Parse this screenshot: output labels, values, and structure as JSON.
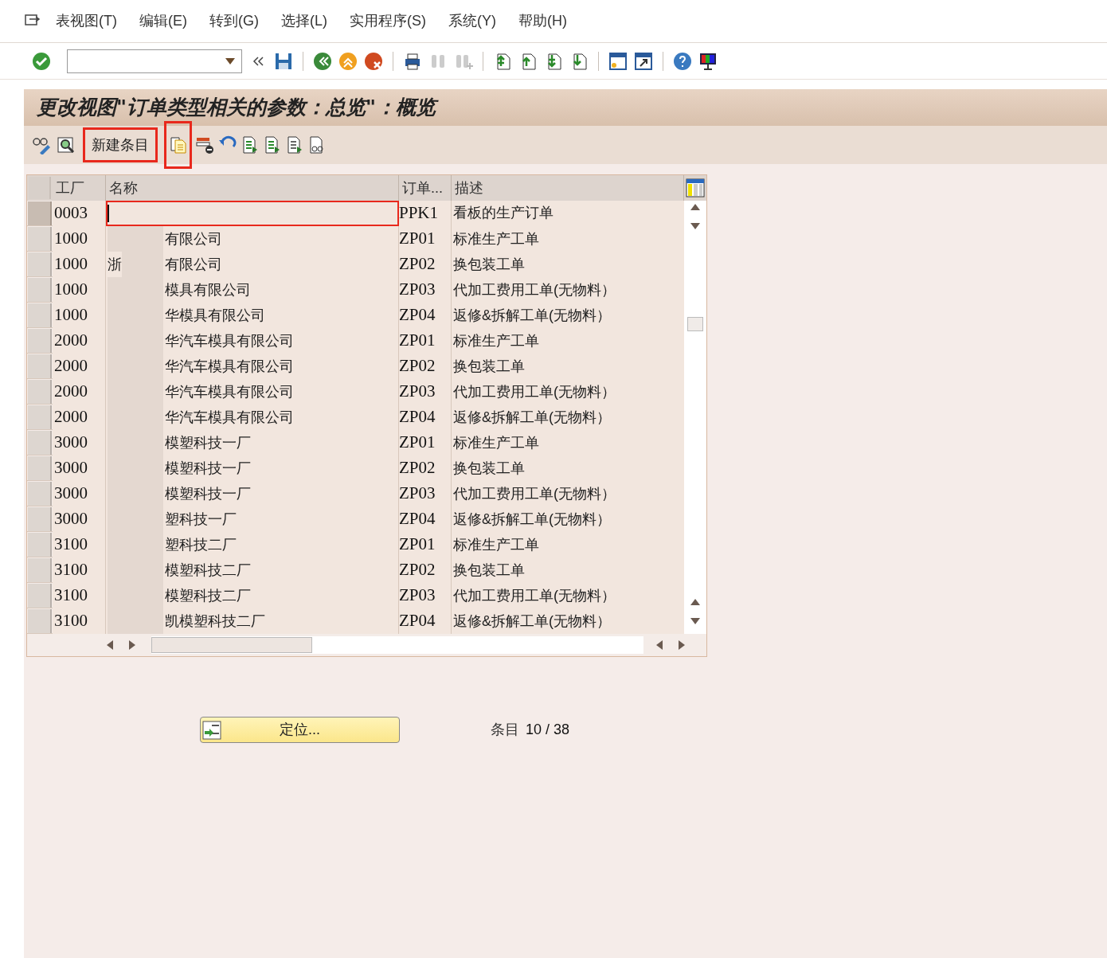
{
  "menu": [
    "表视图(T)",
    "编辑(E)",
    "转到(G)",
    "选择(L)",
    "实用程序(S)",
    "系统(Y)",
    "帮助(H)"
  ],
  "title": "更改视图\"订单类型相关的参数：总览\"：概览",
  "app_toolbar": {
    "new_entries": "新建条目"
  },
  "table": {
    "columns": [
      "工厂",
      "名称",
      "订单...",
      "描述"
    ],
    "rows": [
      {
        "plant": "0003",
        "name_prefix": "",
        "name": "",
        "order": "PPK1",
        "desc": "看板的生产订单",
        "selected": true
      },
      {
        "plant": "1000",
        "name_prefix": "",
        "name": "有限公司",
        "order": "ZP01",
        "desc": "标准生产工单",
        "selected": false
      },
      {
        "plant": "1000",
        "name_prefix": "浙",
        "name": "有限公司",
        "order": "ZP02",
        "desc": "换包装工单",
        "selected": false
      },
      {
        "plant": "1000",
        "name_prefix": "",
        "name": "模具有限公司",
        "order": "ZP03",
        "desc": "代加工费用工单(无物料）",
        "selected": false
      },
      {
        "plant": "1000",
        "name_prefix": "",
        "name": "华模具有限公司",
        "order": "ZP04",
        "desc": "返修&拆解工单(无物料）",
        "selected": false
      },
      {
        "plant": "2000",
        "name_prefix": "",
        "name": "华汽车模具有限公司",
        "order": "ZP01",
        "desc": "标准生产工单",
        "selected": false
      },
      {
        "plant": "2000",
        "name_prefix": "",
        "name": "华汽车模具有限公司",
        "order": "ZP02",
        "desc": "换包装工单",
        "selected": false
      },
      {
        "plant": "2000",
        "name_prefix": "",
        "name": "华汽车模具有限公司",
        "order": "ZP03",
        "desc": "代加工费用工单(无物料）",
        "selected": false
      },
      {
        "plant": "2000",
        "name_prefix": "",
        "name": "华汽车模具有限公司",
        "order": "ZP04",
        "desc": "返修&拆解工单(无物料）",
        "selected": false
      },
      {
        "plant": "3000",
        "name_prefix": "",
        "name": "模塑科技一厂",
        "order": "ZP01",
        "desc": "标准生产工单",
        "selected": false
      },
      {
        "plant": "3000",
        "name_prefix": "",
        "name": "模塑科技一厂",
        "order": "ZP02",
        "desc": "换包装工单",
        "selected": false
      },
      {
        "plant": "3000",
        "name_prefix": "",
        "name": "模塑科技一厂",
        "order": "ZP03",
        "desc": "代加工费用工单(无物料）",
        "selected": false
      },
      {
        "plant": "3000",
        "name_prefix": "",
        "name": "塑科技一厂",
        "order": "ZP04",
        "desc": "返修&拆解工单(无物料）",
        "selected": false
      },
      {
        "plant": "3100",
        "name_prefix": "",
        "name": "塑科技二厂",
        "order": "ZP01",
        "desc": "标准生产工单",
        "selected": false
      },
      {
        "plant": "3100",
        "name_prefix": "",
        "name": "模塑科技二厂",
        "order": "ZP02",
        "desc": "换包装工单",
        "selected": false
      },
      {
        "plant": "3100",
        "name_prefix": "",
        "name": "模塑科技二厂",
        "order": "ZP03",
        "desc": "代加工费用工单(无物料）",
        "selected": false
      },
      {
        "plant": "3100",
        "name_prefix": "",
        "name": "凯模塑科技二厂",
        "order": "ZP04",
        "desc": "返修&拆解工单(无物料）",
        "selected": false
      }
    ]
  },
  "position_button": "定位...",
  "entry_label": "条目",
  "entry_count": "10 / 38"
}
